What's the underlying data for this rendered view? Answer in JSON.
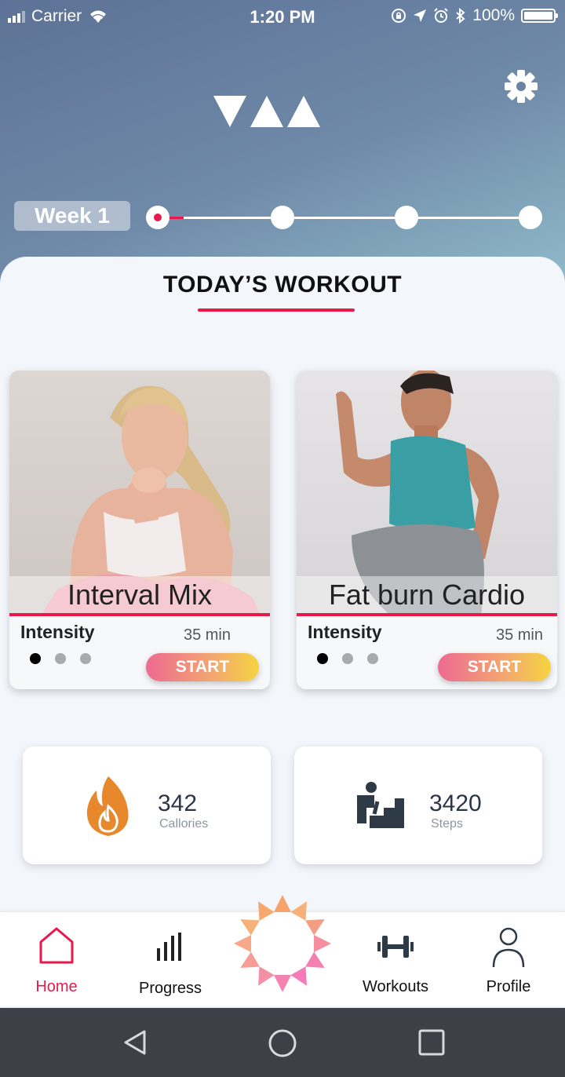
{
  "status_bar": {
    "carrier": "Carrier",
    "time": "1:20 PM",
    "battery": "100%"
  },
  "header": {
    "week_label": "Week 1",
    "week_steps": 4,
    "current_step": 1
  },
  "section": {
    "title": "TODAY’S WORKOUT"
  },
  "workouts": [
    {
      "name": "Interval Mix",
      "intensity_label": "Intensity",
      "duration": "35 min",
      "start_label": "START",
      "intensity_level": 1,
      "intensity_max": 3
    },
    {
      "name": "Fat burn Cardio",
      "intensity_label": "Intensity",
      "duration": "35 min",
      "start_label": "START",
      "intensity_level": 1,
      "intensity_max": 3
    }
  ],
  "stats": [
    {
      "value": "342",
      "label": "Callories",
      "icon": "flame-icon"
    },
    {
      "value": "3420",
      "label": "Steps",
      "icon": "stairs-climber-icon"
    }
  ],
  "tabs": [
    {
      "label": "Home",
      "icon": "home-icon",
      "active": true
    },
    {
      "label": "Progress",
      "icon": "bar-chart-icon",
      "active": false
    },
    {
      "label": "",
      "icon": "starburst-icon",
      "active": false
    },
    {
      "label": "Workouts",
      "icon": "dumbbell-icon",
      "active": false
    },
    {
      "label": "Profile",
      "icon": "person-icon",
      "active": false
    }
  ],
  "colors": {
    "accent": "#e8194b",
    "hero_top": "#5d7296",
    "hero_bottom": "#8fbac9",
    "nav_bar": "#3e4048"
  }
}
